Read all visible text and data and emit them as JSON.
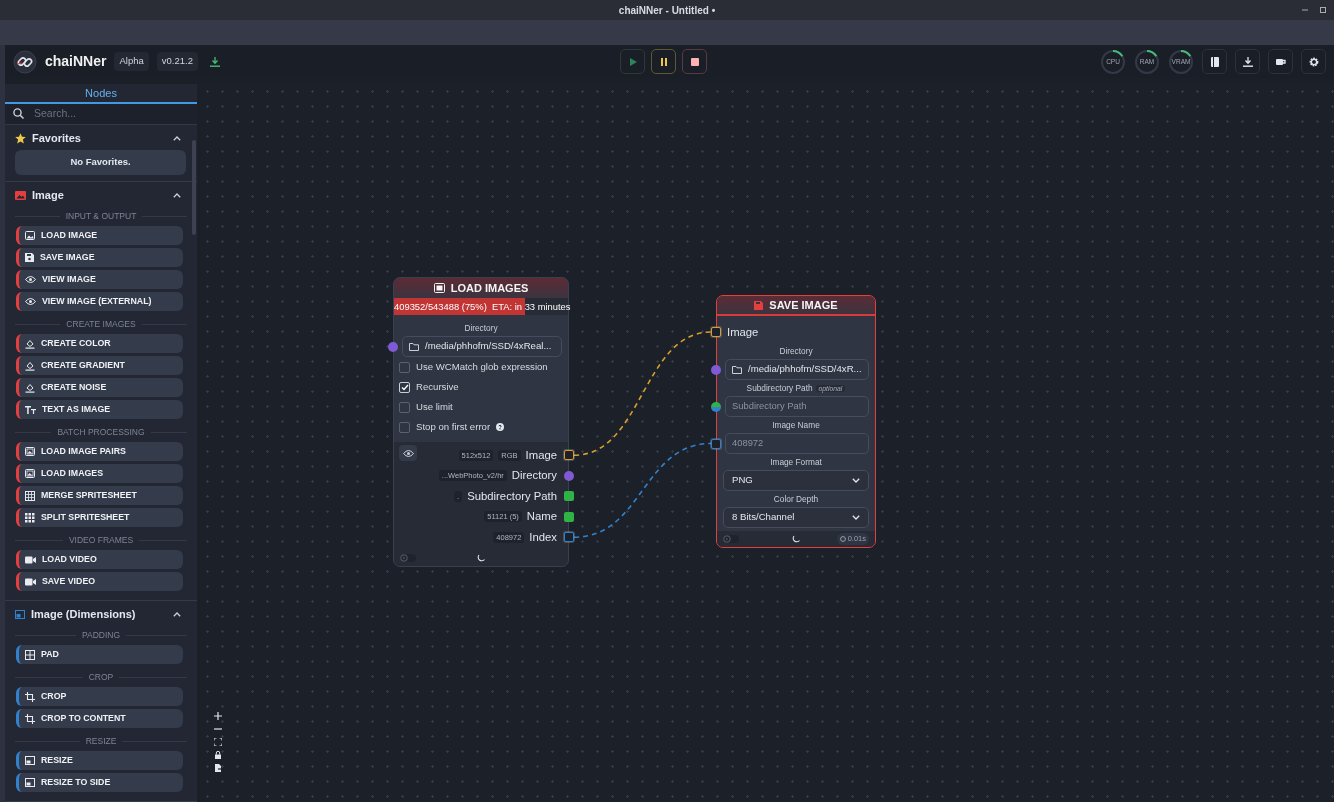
{
  "window": {
    "title": "chaiNNer - Untitled •"
  },
  "header": {
    "app_name": "chaiNNer",
    "badges": [
      "Alpha",
      "v0.21.2"
    ],
    "meters": [
      {
        "label": "CPU"
      },
      {
        "label": "RAM"
      },
      {
        "label": "VRAM"
      }
    ]
  },
  "sidebar": {
    "tab": "Nodes",
    "search": {
      "placeholder": "Search..."
    },
    "categories": [
      {
        "name": "Favorites",
        "kind": "favorites",
        "expanded": true,
        "empty_text": "No Favorites."
      },
      {
        "name": "Image",
        "kind": "image",
        "color": "#e53e3e",
        "expanded": true,
        "groups": [
          {
            "heading": "INPUT & OUTPUT",
            "items": [
              {
                "label": "LOAD IMAGE",
                "kind": "image"
              },
              {
                "label": "SAVE IMAGE",
                "kind": "save"
              },
              {
                "label": "VIEW IMAGE",
                "kind": "eye"
              },
              {
                "label": "VIEW IMAGE (EXTERNAL)",
                "kind": "eye"
              }
            ]
          },
          {
            "heading": "CREATE IMAGES",
            "items": [
              {
                "label": "CREATE COLOR",
                "kind": "fill"
              },
              {
                "label": "CREATE GRADIENT",
                "kind": "fill"
              },
              {
                "label": "CREATE NOISE",
                "kind": "fill"
              },
              {
                "label": "TEXT AS IMAGE",
                "kind": "text"
              }
            ]
          },
          {
            "heading": "BATCH PROCESSING",
            "items": [
              {
                "label": "LOAD IMAGE PAIRS",
                "kind": "images"
              },
              {
                "label": "LOAD IMAGES",
                "kind": "images"
              },
              {
                "label": "MERGE SPRITESHEET",
                "kind": "grid"
              },
              {
                "label": "SPLIT SPRITESHEET",
                "kind": "dots"
              }
            ]
          },
          {
            "heading": "VIDEO FRAMES",
            "items": [
              {
                "label": "LOAD VIDEO",
                "kind": "video"
              },
              {
                "label": "SAVE VIDEO",
                "kind": "video"
              }
            ]
          }
        ]
      },
      {
        "name": "Image (Dimensions)",
        "kind": "dimensions",
        "color": "#3182ce",
        "expanded": true,
        "groups": [
          {
            "heading": "PADDING",
            "items": [
              {
                "label": "PAD",
                "kind": "pad"
              }
            ]
          },
          {
            "heading": "CROP",
            "items": [
              {
                "label": "CROP",
                "kind": "crop"
              },
              {
                "label": "CROP TO CONTENT",
                "kind": "crop"
              }
            ]
          },
          {
            "heading": "RESIZE",
            "items": [
              {
                "label": "RESIZE",
                "kind": "resize"
              },
              {
                "label": "RESIZE TO SIDE",
                "kind": "resize"
              }
            ]
          }
        ]
      }
    ]
  },
  "canvas": {
    "nodes": [
      {
        "title": "LOAD IMAGES",
        "kind": "images",
        "selected": false,
        "progress": {
          "level": 0.75,
          "text": "409352/543488 (75%)  ETA: in 33 minutes"
        },
        "inputs": [
          {
            "kind": "field",
            "label": "Directory",
            "value": "/media/phhofm/SSD/4xReal...",
            "port": {
              "kind": "directory",
              "color": "#805ad5",
              "connected": false
            }
          },
          {
            "kind": "checkbox",
            "label": "Use WCMatch glob expression",
            "checked": false,
            "help": false
          },
          {
            "kind": "checkbox",
            "label": "Recursive",
            "checked": true,
            "help": false
          },
          {
            "kind": "checkbox",
            "label": "Use limit",
            "checked": false,
            "help": false
          },
          {
            "kind": "checkbox",
            "label": "Stop on first error",
            "checked": false,
            "help": true
          }
        ],
        "outputs": [
          {
            "label": "Image",
            "tags": [
              "512x512",
              "RGB"
            ],
            "port": {
              "kind": "image",
              "color": "#d69e2e",
              "connected": true
            }
          },
          {
            "label": "Directory",
            "tags": [
              "...WebPhoto_v2/hr"
            ],
            "port": {
              "kind": "directory",
              "color": "#805ad5",
              "connected": false
            }
          },
          {
            "label": "Subdirectory Path",
            "tags": [
              "."
            ],
            "port": {
              "kind": "text",
              "color": "#2fb344",
              "connected": false
            }
          },
          {
            "label": "Name",
            "tags": [
              "51121 (5)"
            ],
            "port": {
              "kind": "text",
              "color": "#2fb344",
              "connected": false
            }
          },
          {
            "label": "Index",
            "tags": [
              "408972"
            ],
            "port": {
              "kind": "number",
              "color": "#3182ce",
              "connected": true
            }
          }
        ]
      },
      {
        "title": "SAVE IMAGE",
        "kind": "save",
        "selected": true,
        "timer": "0.01s",
        "inputs": [
          {
            "kind": "handle",
            "label": "Image",
            "port": {
              "kind": "image",
              "color": "#d69e2e",
              "connected": true
            }
          },
          {
            "kind": "field",
            "label": "Directory",
            "value": "/media/phhofm/SSD/4xR...",
            "port": {
              "kind": "directory",
              "color": "#805ad5",
              "connected": false
            }
          },
          {
            "kind": "field",
            "label": "Subdirectory Path",
            "tag": "optional",
            "placeholder": "Subdirectory Path",
            "port": {
              "kind": "union",
              "color": "#2fb344",
              "connected": false
            }
          },
          {
            "kind": "field",
            "label": "Image Name",
            "placeholder": "408972",
            "port": {
              "kind": "number",
              "color": "#3182ce",
              "connected": true
            }
          },
          {
            "kind": "select",
            "label": "Image Format",
            "value": "PNG"
          },
          {
            "kind": "select",
            "label": "Color Depth",
            "value": "8 Bits/Channel"
          }
        ]
      }
    ]
  }
}
